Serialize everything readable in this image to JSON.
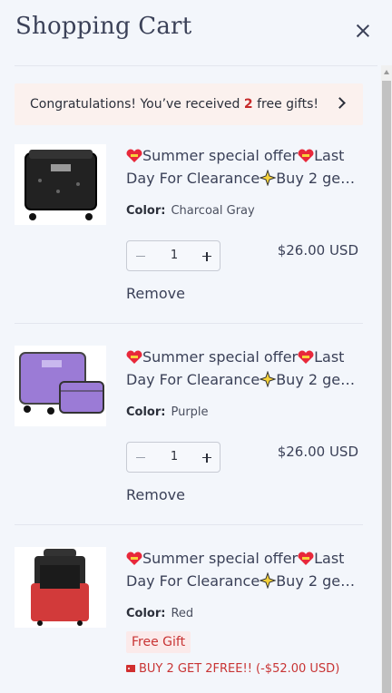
{
  "header": {
    "title": "Shopping Cart",
    "close_icon": "close-icon"
  },
  "gift_banner": {
    "text_before": "Congratulations! You’ve received ",
    "count": "2",
    "text_after": " free gifts!",
    "icon": "chevron-right-icon"
  },
  "colors": {
    "accent_red": "#c62a2a",
    "banner_bg": "#fbf1ee",
    "text": "#3b4158"
  },
  "items": [
    {
      "title_line1": "Summer special offer",
      "title_line1b": "Last",
      "title_line2": "Day For Clearance",
      "title_line2b": "Buy 2 get 2...",
      "color_label": "Color:",
      "color_value": "Charcoal Gray",
      "quantity": "1",
      "price": "$26.00 USD",
      "remove_label": "Remove"
    },
    {
      "title_line1": "Summer special offer",
      "title_line1b": "Last",
      "title_line2": "Day For Clearance",
      "title_line2b": "Buy 2 get 2...",
      "color_label": "Color:",
      "color_value": "Purple",
      "quantity": "1",
      "price": "$26.00 USD",
      "remove_label": "Remove"
    },
    {
      "title_line1": "Summer special offer",
      "title_line1b": "Last",
      "title_line2": "Day For Clearance",
      "title_line2b": "Buy 2 get 2...",
      "color_label": "Color:",
      "color_value": "Red",
      "badge": "Free Gift",
      "discount": "BUY 2 GET 2FREE!! (-$52.00 USD)"
    }
  ]
}
